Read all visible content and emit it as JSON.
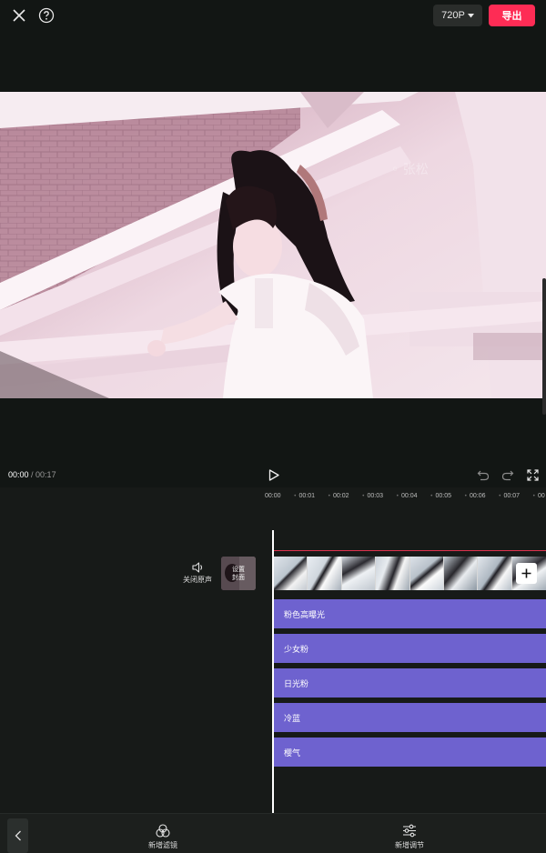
{
  "topbar": {
    "resolution": "720P",
    "export_label": "导出"
  },
  "playback": {
    "current_time": "00:00",
    "separator": " / ",
    "total_time": "00:17"
  },
  "ruler": [
    "00:00",
    "00:01",
    "00:02",
    "00:03",
    "00:04",
    "00:05",
    "00:06",
    "00:07",
    "00"
  ],
  "track": {
    "mute_label": "关闭原声",
    "cover_label_line1": "设置",
    "cover_label_line2": "封面"
  },
  "filters": [
    "粉色高曝光",
    "少女粉",
    "日光粉",
    "冷蓝",
    "樱气"
  ],
  "bottom": {
    "add_filter": "新增滤镜",
    "add_adjust": "新增调节"
  },
  "colors": {
    "accent": "#fe2c55",
    "filter_bar": "#6e62cf",
    "background": "#121614"
  }
}
